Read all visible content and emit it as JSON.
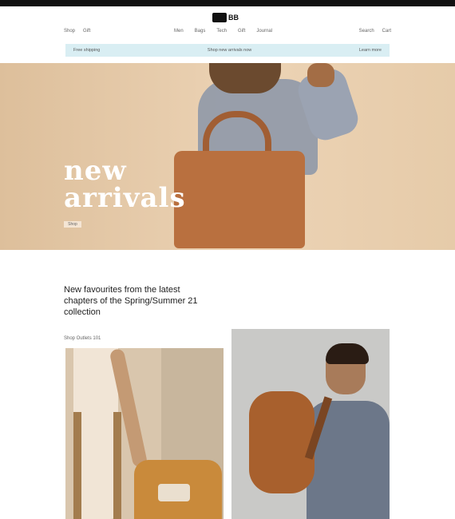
{
  "brand": {
    "logo_text": "BB"
  },
  "nav": {
    "left": [
      "Shop",
      "Gift"
    ],
    "center": [
      "Men",
      "Bags",
      "Tech",
      "Gift",
      "Journal"
    ],
    "right": [
      "Search",
      "Cart"
    ]
  },
  "promo": {
    "left": "Free shipping",
    "center": "Shop new arrivals now",
    "right": "Learn more"
  },
  "hero": {
    "title_line1": "new",
    "title_line2": "arrivals",
    "cta": "Shop"
  },
  "intro": {
    "text": "New favourites from the latest chapters of the Spring/Summer 21 collection"
  },
  "section": {
    "label": "Shop Outlets 101"
  }
}
